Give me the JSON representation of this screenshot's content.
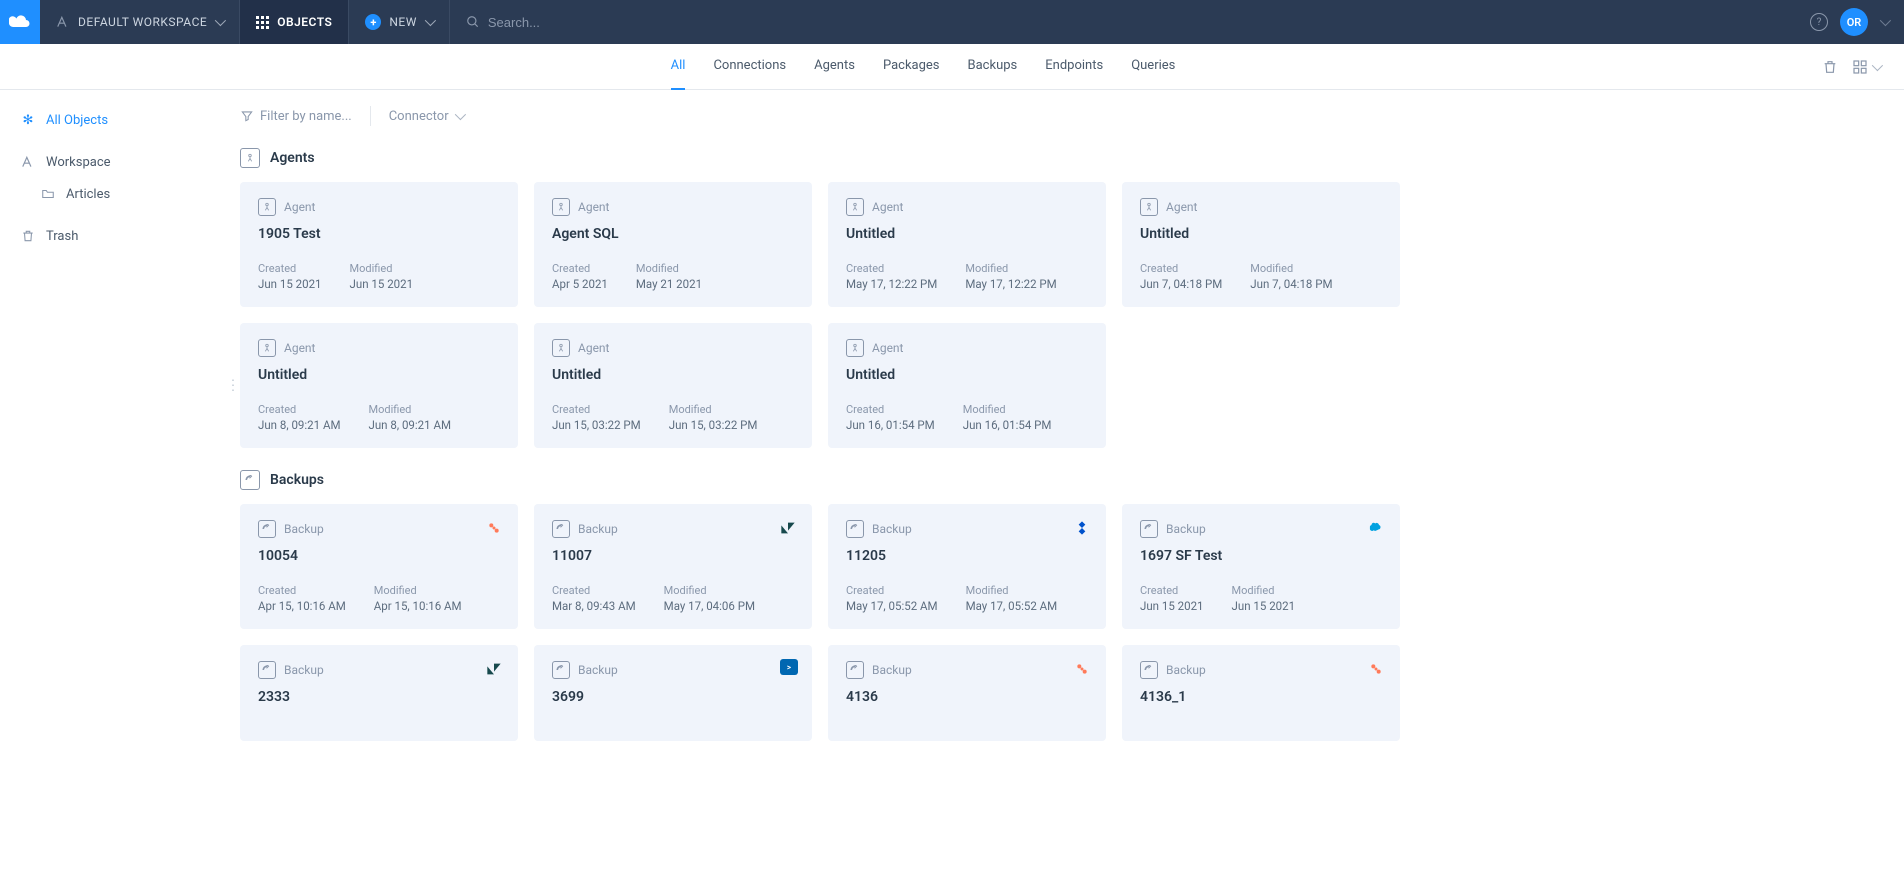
{
  "topbar": {
    "workspace_label": "DEFAULT WORKSPACE",
    "objects_label": "OBJECTS",
    "new_label": "NEW",
    "search_placeholder": "Search...",
    "avatar_initials": "OR"
  },
  "tabs": [
    {
      "label": "All",
      "active": true
    },
    {
      "label": "Connections",
      "active": false
    },
    {
      "label": "Agents",
      "active": false
    },
    {
      "label": "Packages",
      "active": false
    },
    {
      "label": "Backups",
      "active": false
    },
    {
      "label": "Endpoints",
      "active": false
    },
    {
      "label": "Queries",
      "active": false
    }
  ],
  "sidebar": {
    "all_objects": "All Objects",
    "workspace": "Workspace",
    "articles": "Articles",
    "trash": "Trash"
  },
  "filters": {
    "filter_by_name": "Filter by name...",
    "connector": "Connector"
  },
  "meta_labels": {
    "created": "Created",
    "modified": "Modified"
  },
  "type_labels": {
    "agent": "Agent",
    "backup": "Backup"
  },
  "groups": [
    {
      "label": "Agents",
      "type": "agent",
      "items": [
        {
          "title": "1905 Test",
          "created": "Jun 15 2021",
          "modified": "Jun 15 2021"
        },
        {
          "title": "Agent SQL",
          "created": "Apr 5 2021",
          "modified": "May 21 2021"
        },
        {
          "title": "Untitled",
          "created": "May 17, 12:22 PM",
          "modified": "May 17, 12:22 PM"
        },
        {
          "title": "Untitled",
          "created": "Jun 7, 04:18 PM",
          "modified": "Jun 7, 04:18 PM"
        },
        {
          "title": "Untitled",
          "created": "Jun 8, 09:21 AM",
          "modified": "Jun 8, 09:21 AM"
        },
        {
          "title": "Untitled",
          "created": "Jun 15, 03:22 PM",
          "modified": "Jun 15, 03:22 PM"
        },
        {
          "title": "Untitled",
          "created": "Jun 16, 01:54 PM",
          "modified": "Jun 16, 01:54 PM"
        }
      ]
    },
    {
      "label": "Backups",
      "type": "backup",
      "items": [
        {
          "title": "10054",
          "created": "Apr 15, 10:16 AM",
          "modified": "Apr 15, 10:16 AM",
          "connector": "hubspot"
        },
        {
          "title": "11007",
          "created": "Mar 8, 09:43 AM",
          "modified": "May 17, 04:06 PM",
          "connector": "zendesk"
        },
        {
          "title": "11205",
          "created": "May 17, 05:52 AM",
          "modified": "May 17, 05:52 AM",
          "connector": "jira"
        },
        {
          "title": "1697 SF Test",
          "created": "Jun 15 2021",
          "modified": "Jun 15 2021",
          "connector": "salesforce"
        },
        {
          "title": "2333",
          "created": "",
          "modified": "",
          "connector": "zendesk"
        },
        {
          "title": "3699",
          "created": "",
          "modified": "",
          "connector": "sap"
        },
        {
          "title": "4136",
          "created": "",
          "modified": "",
          "connector": "hubspot"
        },
        {
          "title": "4136_1",
          "created": "",
          "modified": "",
          "connector": "hubspot"
        }
      ]
    }
  ]
}
